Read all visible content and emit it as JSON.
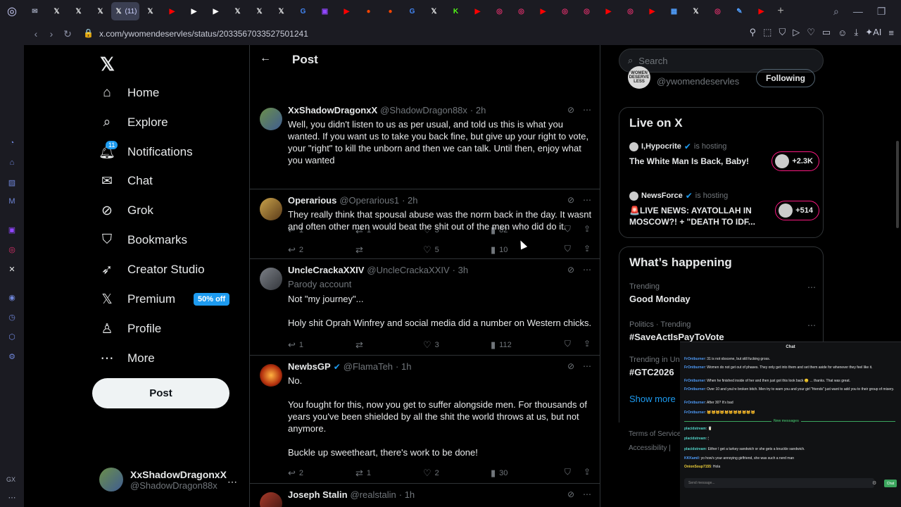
{
  "browser": {
    "url": "x.com/ywomendeservles/status/2033567033527501241",
    "active_tab_count": "(11)",
    "addr_ai_label": "AI",
    "gx_label": "GX",
    "tabs": [
      {
        "icon": "mail-icon",
        "color": "#9aa0b4"
      },
      {
        "icon": "x-icon",
        "color": "#e7e9ea"
      },
      {
        "icon": "x-icon",
        "color": "#e7e9ea"
      },
      {
        "icon": "x-icon",
        "color": "#e7e9ea"
      },
      {
        "icon": "x-icon",
        "color": "#e7e9ea",
        "active": true
      },
      {
        "icon": "x-icon",
        "color": "#e7e9ea"
      },
      {
        "icon": "youtube-icon",
        "color": "#ff0000"
      },
      {
        "icon": "flag-icon",
        "color": "#ffffff"
      },
      {
        "icon": "flag-icon",
        "color": "#ffffff"
      },
      {
        "icon": "x-icon",
        "color": "#e7e9ea"
      },
      {
        "icon": "x-icon",
        "color": "#e7e9ea"
      },
      {
        "icon": "x-icon",
        "color": "#e7e9ea"
      },
      {
        "icon": "google-icon",
        "color": "#4285f4"
      },
      {
        "icon": "twitch-icon",
        "color": "#9146ff"
      },
      {
        "icon": "youtube-icon",
        "color": "#ff0000"
      },
      {
        "icon": "reddit-icon",
        "color": "#ff4500"
      },
      {
        "icon": "reddit-icon",
        "color": "#ff4500"
      },
      {
        "icon": "google-icon",
        "color": "#4285f4"
      },
      {
        "icon": "x-icon",
        "color": "#e7e9ea"
      },
      {
        "icon": "kick-icon",
        "color": "#53fc18"
      },
      {
        "icon": "youtube-icon",
        "color": "#ff0000"
      },
      {
        "icon": "instagram-icon",
        "color": "#e1306c"
      },
      {
        "icon": "instagram-icon",
        "color": "#e1306c"
      },
      {
        "icon": "youtube-icon",
        "color": "#ff0000"
      },
      {
        "icon": "instagram-icon",
        "color": "#e1306c"
      },
      {
        "icon": "instagram-icon",
        "color": "#e1306c"
      },
      {
        "icon": "youtube-icon",
        "color": "#ff0000"
      },
      {
        "icon": "instagram-icon",
        "color": "#e1306c"
      },
      {
        "icon": "youtube-icon",
        "color": "#ff0000"
      },
      {
        "icon": "chart-icon",
        "color": "#4f9cf9"
      },
      {
        "icon": "x-icon",
        "color": "#e7e9ea"
      },
      {
        "icon": "instagram-icon",
        "color": "#e1306c"
      },
      {
        "icon": "edit-icon",
        "color": "#4f9cf9"
      },
      {
        "icon": "youtube-icon",
        "color": "#ff0000"
      }
    ]
  },
  "nav": {
    "items": [
      {
        "label": "Home",
        "icon": "home-icon"
      },
      {
        "label": "Explore",
        "icon": "search-icon"
      },
      {
        "label": "Notifications",
        "icon": "bell-icon",
        "badge": "11"
      },
      {
        "label": "Chat",
        "icon": "mail-icon"
      },
      {
        "label": "Grok",
        "icon": "grok-icon"
      },
      {
        "label": "Bookmarks",
        "icon": "bookmark-icon"
      },
      {
        "label": "Creator Studio",
        "icon": "rocket-icon"
      },
      {
        "label": "Premium",
        "icon": "x-icon",
        "tag": "50% off"
      },
      {
        "label": "Profile",
        "icon": "person-icon"
      },
      {
        "label": "More",
        "icon": "more-circle-icon"
      }
    ],
    "post_button": "Post",
    "account": {
      "name": "XxShadowDragonxX",
      "handle": "@ShadowDragon88x"
    }
  },
  "feed": {
    "title": "Post",
    "tweets": [
      {
        "name": "XxShadowDragonxX",
        "handle": "@ShadowDragon88x",
        "time": "· 2h",
        "verified": false,
        "text": "Well, you didn't listen to us as per usual, and told us this is what you wanted. If you want us to take you back fine, but give up your right to vote, your \"right\" to kill the unborn and then we can talk. Until then, enjoy what you wanted",
        "replies": "1",
        "reposts": "1",
        "likes": "3",
        "views": "82"
      },
      {
        "name": "Operarious",
        "handle": "@Operarious1",
        "time": "· 2h",
        "verified": false,
        "text": "They really think that spousal abuse was the norm back in the day. It wasnt and often other men would beat the shit out of the men who did do it.",
        "replies": "2",
        "reposts": "",
        "likes": "5",
        "views": "10"
      },
      {
        "name": "UncleCrackaXXIV",
        "handle": "@UncleCrackaXXIV",
        "time": "· 3h",
        "verified": false,
        "parody": "Parody account",
        "text": "Not \"my journey\"...\n\nHoly shit Oprah Winfrey and social media did a number on Western chicks.",
        "replies": "1",
        "reposts": "",
        "likes": "3",
        "views": "112"
      },
      {
        "name": "NewbsGP",
        "handle": "@FlamaTeh",
        "time": "· 1h",
        "verified": true,
        "text": "No.\n\nYou fought for this, now you get to suffer alongside men. For thousands of years you've been shielded by all the shit the world throws at us, but not anymore.\n\nBuckle up sweetheart, there's work to be done!",
        "replies": "2",
        "reposts": "1",
        "likes": "2",
        "views": "30"
      },
      {
        "name": "Joseph Stalin",
        "handle": "@realstalin",
        "time": "· 1h",
        "verified": false,
        "text": "",
        "replies": "",
        "reposts": "",
        "likes": "",
        "views": ""
      }
    ]
  },
  "right": {
    "search_placeholder": "Search",
    "following_handle": "@ywomendeservles",
    "following_label": "Following",
    "following_avatar_text": "WOMEN DESERVE LESS",
    "live": {
      "title": "Live on X",
      "items": [
        {
          "host": "I,Hypocrite",
          "hosting": "is hosting",
          "title": "The White Man Is Back, Baby!",
          "count": "+2.3K"
        },
        {
          "host": "NewsForce",
          "hosting": "is hosting",
          "title": "🚨LIVE NEWS: AYATOLLAH IN MOSCOW?! + \"DEATH TO IDF...",
          "count": "+514"
        }
      ]
    },
    "happening": {
      "title": "What’s happening",
      "trends": [
        {
          "meta": "Trending",
          "name": "Good Monday"
        },
        {
          "meta": "Politics · Trending",
          "name": "#SaveActIsPayToVote"
        },
        {
          "meta": "Trending in Uni",
          "name": "#GTC2026"
        }
      ],
      "show_more": "Show more"
    },
    "footer": [
      "Terms of Service",
      "Accessibility |"
    ]
  },
  "chat": {
    "title": "Chat",
    "messages": [
      {
        "user": "FrOntburner",
        "text": ": 31 is not obscene, but still fucking gross."
      },
      {
        "user": "FrOntburner",
        "text": ": Women do not get out of phases. They only get into them and set them aside for whenever they feel like it."
      },
      {
        "user": "FrOntburner",
        "text": ": When he finished inside of her and then just got this look back 😐 ... thanks. That was great."
      },
      {
        "user": "FrOntburner",
        "text": ": Over 10 and you're broken bitch. Men try to warn you and your girl \"friends\" just want to add you to their group of misery."
      },
      {
        "user": "FrOntburner",
        "text": ": After 30? It's bad"
      },
      {
        "user": "FrOntburner",
        "text": ": 🐱🐱🐱🐱🐱🐱🐱🐱🐱🐱🐱"
      },
      {
        "user": "placidstream",
        "text": ": 🥛"
      },
      {
        "user": "placidstream",
        "text": ": 🕯"
      },
      {
        "user": "placidstream",
        "text": ": Either I get a turkey sandwich or she gets a knuckle sandwich."
      },
      {
        "user": "KKKamil",
        "text": ": yo how's your annoying girlfriend, she was such a nerd man"
      },
      {
        "user": "OnionSoup7155",
        "text": ": Hola"
      }
    ],
    "new_messages": "New messages",
    "input_placeholder": "Send message...",
    "send_label": "Chat"
  }
}
